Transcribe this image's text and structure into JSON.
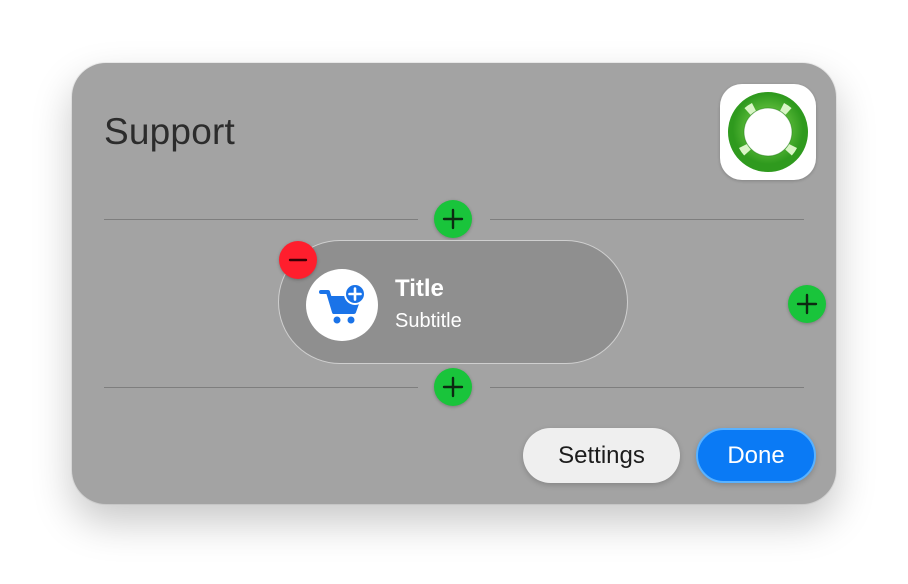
{
  "panel": {
    "title": "Support",
    "app_icon": "lifebuoy-icon"
  },
  "widget": {
    "title": "Title",
    "subtitle": "Subtitle",
    "icon": "cart-add-icon"
  },
  "controls": {
    "add_icon": "plus-icon",
    "remove_icon": "minus-icon"
  },
  "buttons": {
    "settings_label": "Settings",
    "done_label": "Done"
  },
  "colors": {
    "panel_bg": "#a3a3a3",
    "add_green": "#19c43b",
    "remove_red": "#ff1e2d",
    "done_blue": "#0a7af5",
    "cart_blue": "#1a73e8"
  }
}
